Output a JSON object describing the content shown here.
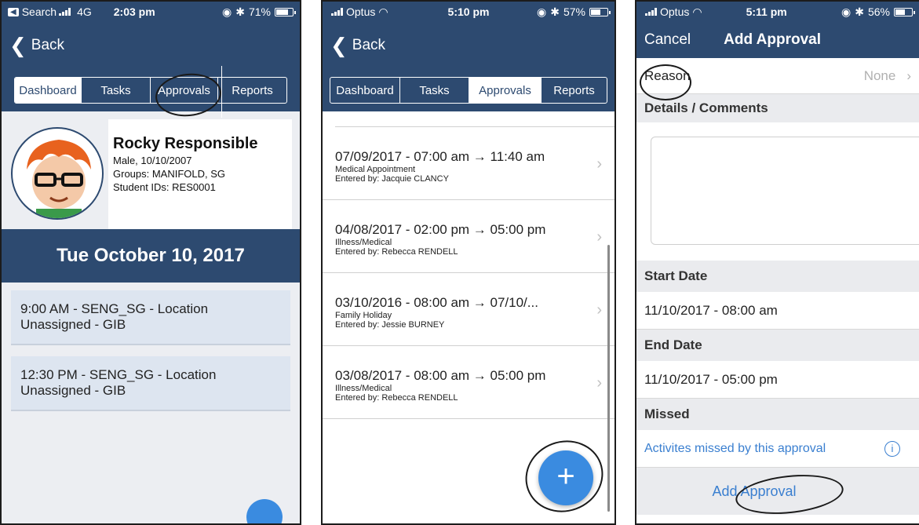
{
  "screen1": {
    "status": {
      "carrier": "Search",
      "network": "4G",
      "time": "2:03 pm",
      "battery": "71%",
      "alarm_icon": "alarm-icon",
      "bt_icon": "bluetooth-icon"
    },
    "nav": {
      "back_label": "Back"
    },
    "tabs": [
      {
        "label": "Dashboard",
        "active": true
      },
      {
        "label": "Tasks",
        "active": false
      },
      {
        "label": "Approvals",
        "active": false
      },
      {
        "label": "Reports",
        "active": false
      }
    ],
    "profile": {
      "name": "Rocky Responsible",
      "details": "Male, 10/10/2007",
      "groups": "Groups: MANIFOLD, SG",
      "student_ids": "Student IDs: RES0001"
    },
    "date": "Tue October 10, 2017",
    "events": [
      {
        "text": "9:00 AM - SENG_SG - Location Unassigned - GIB"
      },
      {
        "text": "12:30 PM - SENG_SG - Location Unassigned - GIB"
      }
    ]
  },
  "screen2": {
    "status": {
      "carrier": "Optus",
      "time": "5:10 pm",
      "battery": "57%"
    },
    "nav": {
      "back_label": "Back"
    },
    "tabs": [
      {
        "label": "Dashboard",
        "active": false
      },
      {
        "label": "Tasks",
        "active": false
      },
      {
        "label": "Approvals",
        "active": true
      },
      {
        "label": "Reports",
        "active": false
      }
    ],
    "approvals": [
      {
        "title": "07/09/2017 - 07:00 am → 11:40 am",
        "reason": "Medical Appointment",
        "entered_by": "Entered by: Jacquie CLANCY"
      },
      {
        "title": "04/08/2017 - 02:00 pm → 05:00 pm",
        "reason": "Illness/Medical",
        "entered_by": "Entered by: Rebecca RENDELL"
      },
      {
        "title": "03/10/2016 - 08:00 am → 07/10/...",
        "reason": "Family Holiday",
        "entered_by": "Entered by: Jessie BURNEY"
      },
      {
        "title": "03/08/2017 - 08:00 am → 05:00 pm",
        "reason": "Illness/Medical",
        "entered_by": "Entered by: Rebecca RENDELL"
      }
    ],
    "fab_label": "+"
  },
  "screen3": {
    "status": {
      "carrier": "Optus",
      "time": "5:11 pm",
      "battery": "56%"
    },
    "nav": {
      "cancel_label": "Cancel",
      "title": "Add Approval"
    },
    "reason_label": "Reason",
    "reason_value": "None",
    "details_header": "Details / Comments",
    "start_header": "Start Date",
    "start_value": "11/10/2017 - 08:00 am",
    "end_header": "End Date",
    "end_value": "11/10/2017 - 05:00 pm",
    "missed_header": "Missed",
    "missed_link": "Activites missed by this approval",
    "info_icon": "info-icon",
    "submit_label": "Add Approval"
  },
  "colors": {
    "navy": "#2d4a70",
    "accent": "#3a8be0",
    "event_bg": "#dde5f0",
    "section_bg": "#eaebee"
  }
}
